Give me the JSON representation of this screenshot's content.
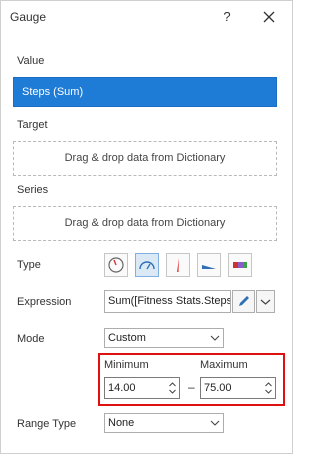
{
  "dialog": {
    "title": "Gauge",
    "help_label": "?"
  },
  "value": {
    "label": "Value",
    "field": "Steps (Sum)"
  },
  "target": {
    "label": "Target",
    "drop_text": "Drag & drop data from Dictionary"
  },
  "series": {
    "label": "Series",
    "drop_text": "Drag & drop data from Dictionary"
  },
  "type": {
    "label": "Type",
    "icons": [
      "radial-full-gauge-icon",
      "radial-half-gauge-icon",
      "needle-gauge-icon",
      "linear-gauge-icon",
      "bullet-gauge-icon"
    ],
    "selected_index": 1
  },
  "expression": {
    "label": "Expression",
    "value": "Sum([Fitness Stats.Steps])"
  },
  "mode": {
    "label": "Mode",
    "selected": "Custom"
  },
  "range": {
    "minimum_label": "Minimum",
    "maximum_label": "Maximum",
    "minimum_value": "14.00",
    "maximum_value": "75.00",
    "separator": "–"
  },
  "range_type": {
    "label": "Range Type",
    "selected": "None"
  },
  "colors": {
    "selected_field_bg": "#1e7bd6",
    "highlight_border": "#e01010",
    "active_type_bg": "#dbe9f7",
    "edit_pencil": "#2f6fb5"
  }
}
